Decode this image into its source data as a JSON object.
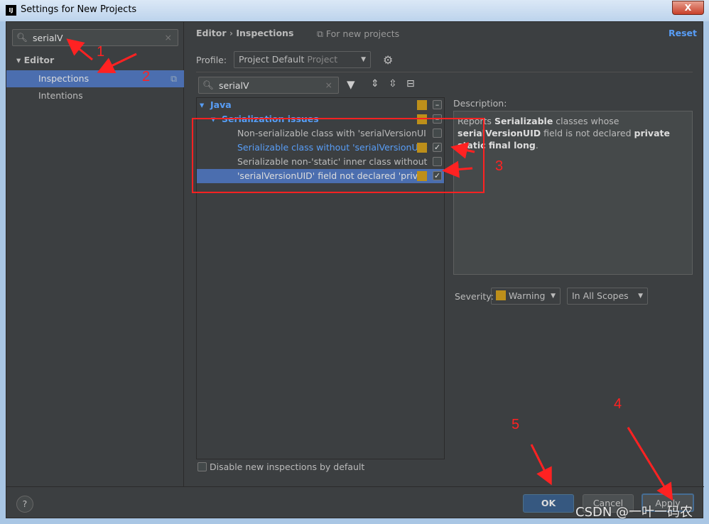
{
  "window": {
    "title": "Settings for New Projects",
    "app_icon": "IJ",
    "close": "X"
  },
  "sidebar": {
    "search_value": "serialV",
    "items": [
      {
        "label": "Editor"
      },
      {
        "label": "Inspections"
      },
      {
        "label": "Intentions"
      }
    ]
  },
  "header": {
    "breadcrumb": [
      "Editor",
      "Inspections"
    ],
    "scope_note": "For new projects",
    "reset_label": "Reset"
  },
  "profile": {
    "label": "Profile:",
    "value": "Project Default",
    "type": "Project"
  },
  "filter": {
    "search_value": "serialV"
  },
  "tree": {
    "group": "Java",
    "subgroup": "Serialization issues",
    "items": [
      {
        "label": "Non-serializable class with 'serialVersionUI",
        "checked": false,
        "highlight": false
      },
      {
        "label": "Serializable class without 'serialVersionUID",
        "checked": true,
        "highlight": true
      },
      {
        "label": "Serializable non-'static' inner class without",
        "checked": false,
        "highlight": false
      },
      {
        "label": "'serialVersionUID' field not declared 'privat",
        "checked": true,
        "selected": true
      }
    ]
  },
  "description": {
    "label": "Description:",
    "parts": [
      "Reports ",
      "Serializable",
      " classes whose ",
      "serialVersionUID",
      " field is not declared ",
      "private static final long",
      "."
    ]
  },
  "severity": {
    "label": "Severity:",
    "value": "Warning",
    "scope": "In All Scopes",
    "color": "#bd8f1a"
  },
  "disable_new": {
    "label": "Disable new inspections by default",
    "checked": false
  },
  "buttons": {
    "help": "?",
    "ok": "OK",
    "cancel": "Cancel",
    "apply": "Apply"
  },
  "annotations": [
    "1",
    "2",
    "3",
    "4",
    "5"
  ],
  "watermark": "CSDN @一叶一码农",
  "colors": {
    "accent": "#4b6eaf",
    "link": "#589df6",
    "annotation": "#ff2222"
  }
}
